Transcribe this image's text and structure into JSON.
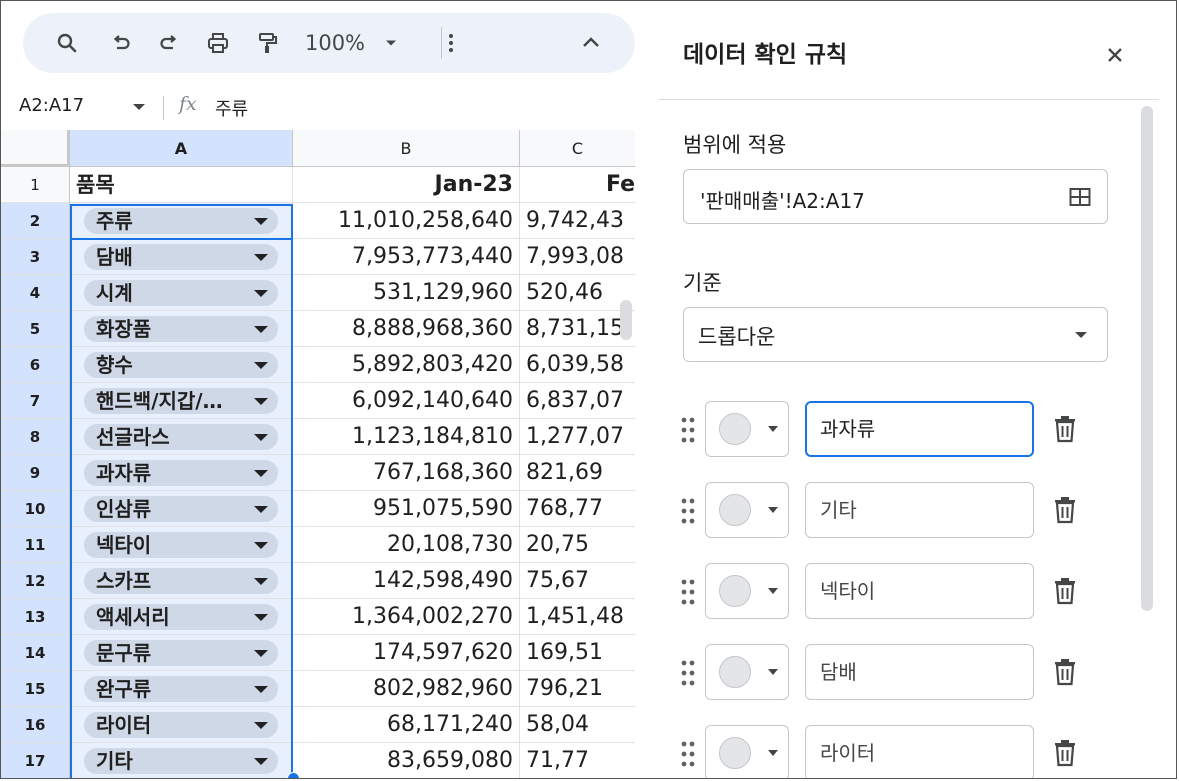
{
  "toolbar": {
    "zoom": "100%"
  },
  "namebox": {
    "value": "A2:A17",
    "formula_icon": "fx",
    "formula": "주류"
  },
  "grid": {
    "columns": [
      "A",
      "B",
      "C"
    ],
    "header_row": {
      "num": "1",
      "a": "품목",
      "b": "Jan-23",
      "c": "Fe"
    },
    "rows": [
      {
        "num": "2",
        "a": "주류",
        "b": "11,010,258,640",
        "c": "9,742,43"
      },
      {
        "num": "3",
        "a": "담배",
        "b": "7,953,773,440",
        "c": "7,993,08"
      },
      {
        "num": "4",
        "a": "시계",
        "b": "531,129,960",
        "c": "520,46"
      },
      {
        "num": "5",
        "a": "화장품",
        "b": "8,888,968,360",
        "c": "8,731,15"
      },
      {
        "num": "6",
        "a": "향수",
        "b": "5,892,803,420",
        "c": "6,039,58"
      },
      {
        "num": "7",
        "a": "핸드백/지갑/…",
        "b": "6,092,140,640",
        "c": "6,837,07"
      },
      {
        "num": "8",
        "a": "선글라스",
        "b": "1,123,184,810",
        "c": "1,277,07"
      },
      {
        "num": "9",
        "a": "과자류",
        "b": "767,168,360",
        "c": "821,69"
      },
      {
        "num": "10",
        "a": "인삼류",
        "b": "951,075,590",
        "c": "768,77"
      },
      {
        "num": "11",
        "a": "넥타이",
        "b": "20,108,730",
        "c": "20,75"
      },
      {
        "num": "12",
        "a": "스카프",
        "b": "142,598,490",
        "c": "75,67"
      },
      {
        "num": "13",
        "a": "액세서리",
        "b": "1,364,002,270",
        "c": "1,451,48"
      },
      {
        "num": "14",
        "a": "문구류",
        "b": "174,597,620",
        "c": "169,51"
      },
      {
        "num": "15",
        "a": "완구류",
        "b": "802,982,960",
        "c": "796,21"
      },
      {
        "num": "16",
        "a": "라이터",
        "b": "68,171,240",
        "c": "58,04"
      },
      {
        "num": "17",
        "a": "기타",
        "b": "83,659,080",
        "c": "71,77"
      }
    ]
  },
  "panel": {
    "title": "데이터 확인 규칙",
    "range_label": "범위에 적용",
    "range_value": "'판매매출'!A2:A17",
    "criteria_label": "기준",
    "criteria_value": "드롭다운",
    "options": [
      "과자류",
      "기타",
      "넥타이",
      "담배",
      "라이터"
    ]
  },
  "colors": {
    "accent": "#1a73e8",
    "selected_header": "#d3e3fd",
    "chip": "#cfd8e6",
    "toolbar_bg": "#edf2fa"
  }
}
